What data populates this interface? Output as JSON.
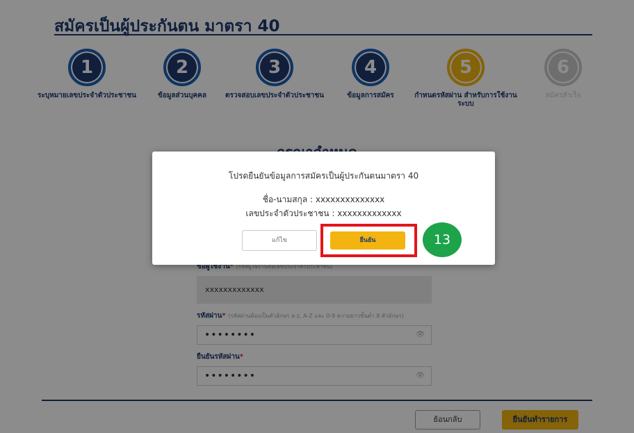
{
  "page": {
    "title": "สมัครเป็นผู้ประกันตน มาตรา 40",
    "section_heading": "กรุณากำหนด"
  },
  "stepper": {
    "steps": [
      {
        "number": "1",
        "label": "ระบุหมายเลขประจำตัวประชาชน",
        "state": "done"
      },
      {
        "number": "2",
        "label": "ข้อมูลส่วนบุคคล",
        "state": "done"
      },
      {
        "number": "3",
        "label": "ตรวจสอบเลขประจำตัวประชาชน",
        "state": "done"
      },
      {
        "number": "4",
        "label": "ข้อมูลการสมัคร",
        "state": "done"
      },
      {
        "number": "5",
        "label": "กำหนดรหัสผ่าน สำหรับการใช้งานระบบ",
        "state": "active"
      },
      {
        "number": "6",
        "label": "สมัครสำเร็จ",
        "state": "todo"
      }
    ]
  },
  "form": {
    "username_label": "ชื่อผู้ใช้งาน",
    "username_hint": "(รหัสผู้ใช้งานคือเลขประจำตัวประชาชน)",
    "username_value": "xxxxxxxxxxxxx",
    "password_label": "รหัสผ่าน",
    "password_hint": "(รหัสผ่านต้องเป็นตัวอักษร a-z, A-Z และ 0-9 ความยาวขั้นต่ำ 8 ตัวอักษร)",
    "password_value": "••••••••",
    "confirm_password_label": "ยืนยันรหัสผ่าน",
    "confirm_password_value": "••••••••",
    "required_mark": "*"
  },
  "footer": {
    "back_label": "ย้อนกลับ",
    "confirm_label": "ยืนยันทำรายการ"
  },
  "modal": {
    "title": "โปรดยืนยันข้อมูลการสมัครเป็นผู้ประกันตนมาตรา 40",
    "name_line": "ชื่อ-นามสกุล : xxxxxxxxxxxxxx",
    "id_line": "เลขประจำตัวประชาชน : xxxxxxxxxxxxx",
    "edit_label": "แก้ไข",
    "ok_label": "ยืนยัน"
  },
  "annotation": {
    "step_number": "13"
  },
  "colors": {
    "primary": "#1f3a6e",
    "accent": "#f3b411",
    "highlight": "#e3141c",
    "badge": "#1da34a"
  }
}
